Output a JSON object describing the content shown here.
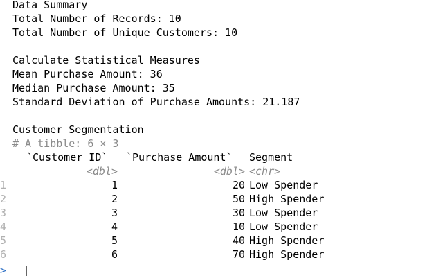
{
  "summary": {
    "heading": "Data Summary",
    "total_records": "Total Number of Records: 10",
    "unique_customers": "Total Number of Unique Customers: 10"
  },
  "stats": {
    "heading": "Calculate Statistical Measures",
    "mean": "Mean Purchase Amount: 36",
    "median": "Median Purchase Amount: 35",
    "sd": "Standard Deviation of Purchase Amounts: 21.187"
  },
  "segmentation": {
    "heading": "Customer Segmentation",
    "tibble_desc": "# A tibble: 6 × 3",
    "columns": [
      "`Customer ID`",
      "`Purchase Amount`",
      "Segment"
    ],
    "types": [
      "<dbl>",
      "<dbl>",
      "<chr>"
    ],
    "rows": [
      {
        "n": "1",
        "id": "1",
        "amount": "20",
        "segment": "Low Spender"
      },
      {
        "n": "2",
        "id": "2",
        "amount": "50",
        "segment": "High Spender"
      },
      {
        "n": "3",
        "id": "3",
        "amount": "30",
        "segment": "Low Spender"
      },
      {
        "n": "4",
        "id": "4",
        "amount": "10",
        "segment": "Low Spender"
      },
      {
        "n": "5",
        "id": "5",
        "amount": "40",
        "segment": "High Spender"
      },
      {
        "n": "6",
        "id": "6",
        "amount": "70",
        "segment": "High Spender"
      }
    ]
  },
  "console": {
    "prompt": ">"
  },
  "colors": {
    "prompt": "#2a6dc4",
    "type_header": "#8a8a8a",
    "row_number": "#b0b0b0"
  }
}
